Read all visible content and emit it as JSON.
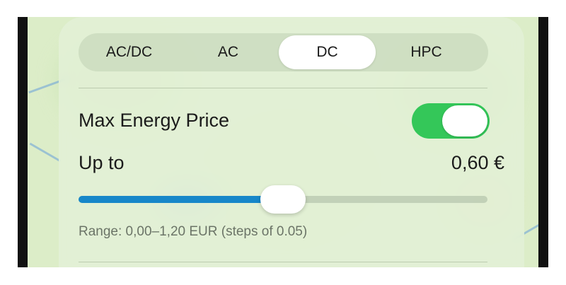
{
  "segments": {
    "items": [
      {
        "label": "AC/DC"
      },
      {
        "label": "AC"
      },
      {
        "label": "DC"
      },
      {
        "label": "HPC"
      }
    ],
    "selected": "DC"
  },
  "max_price": {
    "label": "Max Energy Price",
    "enabled": true
  },
  "up_to": {
    "label": "Up to",
    "value_text": "0,60 €",
    "value": 0.6,
    "min": 0.0,
    "max": 1.2,
    "step": 0.05
  },
  "hint": "Range: 0,00–1,20 EUR (steps of 0.05)",
  "colors": {
    "accent": "#1787c9",
    "toggle_on": "#34c759"
  }
}
